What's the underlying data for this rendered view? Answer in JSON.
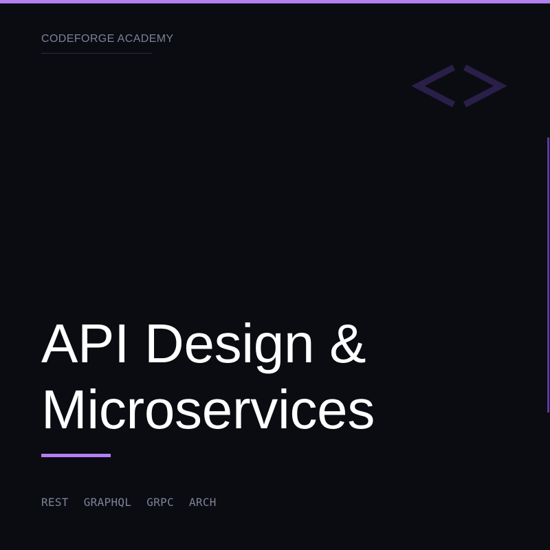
{
  "brand": {
    "name": "CODEFORGE ACADEMY"
  },
  "logo": {
    "icon": "code-brackets-icon",
    "color": "#2a1f48"
  },
  "title": {
    "line1": "API Design &",
    "line2": "Microservices"
  },
  "tags": [
    "REST",
    "GRAPHQL",
    "GRPC",
    "ARCH"
  ],
  "colors": {
    "background": "#0a0c12",
    "accent": "#b27ef0",
    "accent_dim": "#5f3aa3",
    "muted_text": "#7d8396",
    "title_text": "#ffffff"
  }
}
